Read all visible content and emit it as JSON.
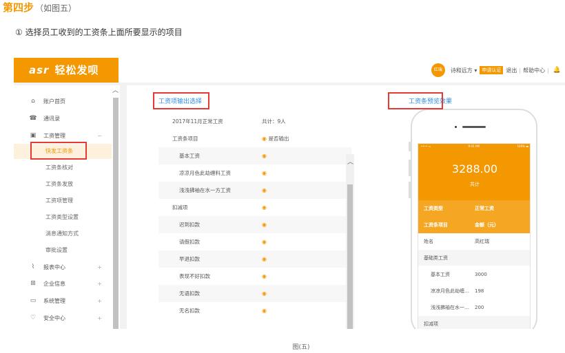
{
  "heading": {
    "title": "第四步",
    "note": "（如图五）"
  },
  "instruction": "① 选择员工收到的工资条上面所要显示的项目",
  "app": {
    "logo_mark": "asr",
    "logo_text": "轻松发呗",
    "user": {
      "avatar_text": "红瑞",
      "company": "诗和远方 ▾",
      "verify_badge": "申请认证",
      "logout": "退出",
      "help": "帮助中心"
    }
  },
  "sidebar": {
    "items": [
      {
        "icon": "⌂",
        "label": "账户首页"
      },
      {
        "icon": "☎",
        "label": "通讯录"
      },
      {
        "icon": "▣",
        "label": "工资管理",
        "expand": "−"
      }
    ],
    "sub_items": [
      "快发工资条",
      "工资条核对",
      "工资条发放",
      "工资项管理",
      "工资类型设置",
      "消息通知方式",
      "审批设置"
    ],
    "items_after": [
      {
        "icon": "⌇",
        "label": "报表中心",
        "expand": "+"
      },
      {
        "icon": "⊞",
        "label": "企业信息",
        "expand": "+"
      },
      {
        "icon": "▭",
        "label": "系统管理",
        "expand": "+"
      },
      {
        "icon": "♡",
        "label": "安全中心",
        "expand": "+"
      }
    ]
  },
  "left_panel": {
    "title": "工资项输出选择",
    "header": {
      "month": "2017年11月正常工资",
      "count": "共计：9人"
    },
    "col_item": "工资条项目",
    "col_output": "是否输出",
    "rows": [
      {
        "label": "基本工资",
        "sub": true
      },
      {
        "label": "凉凉月色此劫缠料工资",
        "sub": true
      },
      {
        "label": "浅浅拂袖在水一方工资",
        "sub": true
      },
      {
        "label": "扣减项",
        "sub": false
      },
      {
        "label": "迟到扣款",
        "sub": true
      },
      {
        "label": "请假扣款",
        "sub": true
      },
      {
        "label": "早退扣款",
        "sub": true
      },
      {
        "label": "表现不好扣款",
        "sub": true
      },
      {
        "label": "无语扣款",
        "sub": true
      },
      {
        "label": "无名扣款",
        "sub": true
      }
    ]
  },
  "right_panel": {
    "title": "工资条预览效果",
    "status": {
      "left": "•••• ≈",
      "time": "9:41 AM",
      "right": "100% ▬"
    },
    "amount": "3288.00",
    "amount_label": "共计",
    "info": [
      {
        "k": "工资类型",
        "v": "正常工资"
      },
      {
        "k": "工资条项目",
        "v": "金额（元）"
      }
    ],
    "rows": [
      {
        "k": "姓名",
        "v": "高红瑞",
        "sub": false
      },
      {
        "k": "基础类工资",
        "v": "",
        "sub": false
      },
      {
        "k": "基本工资",
        "v": "3000",
        "sub": true
      },
      {
        "k": "凉凉月色此劫缠料...",
        "v": "198",
        "sub": true
      },
      {
        "k": "浅浅拂袖在水一方...",
        "v": "200",
        "sub": true
      },
      {
        "k": "扣减项",
        "v": "",
        "sub": false
      }
    ]
  },
  "caption": "图(五)",
  "colors": {
    "accent": "#f39800",
    "link": "#2e8be6",
    "highlight": "#e53935"
  }
}
